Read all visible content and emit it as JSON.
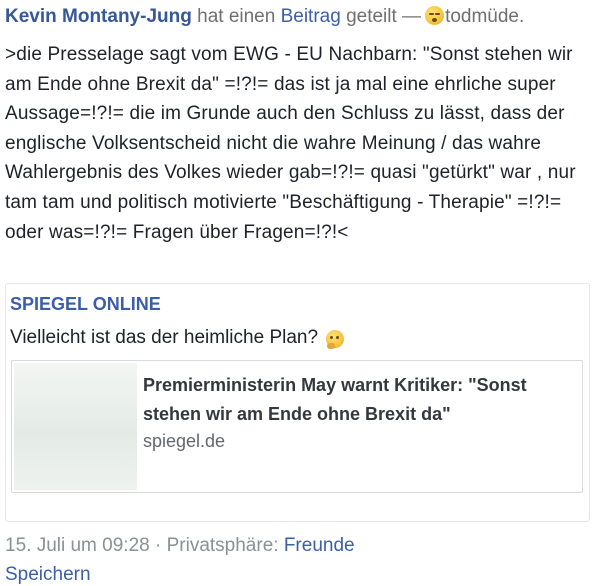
{
  "post": {
    "author": "Kevin Montany-Jung",
    "action_prefix": "hat einen",
    "action_link": "Beitrag",
    "action_suffix": "geteilt —",
    "feeling_icon": "sleepy-face-icon",
    "feeling": "todmüde.",
    "text": ">die Presselage sagt vom EWG - EU Nachbarn: \"Sonst stehen wir am Ende ohne Brexit da\" =!?!= das ist ja mal eine ehrliche super Aussage=!?!= die im Grunde auch den Schluss zu lässt, dass der englische Volksentscheid nicht die wahre Meinung / das wahre Wahlergebnis des Volkes wieder gab=!?!= quasi \"getürkt\" war , nur tam tam und politisch motivierte \"Beschäftigung - Therapie\" =!?!= oder was=!?!= Fragen über Fragen=!?!<"
  },
  "shared": {
    "source": "SPIEGEL ONLINE",
    "text": "Vielleicht ist das der heimliche Plan?",
    "emoji_icon": "thinking-face-icon",
    "link": {
      "title": "Premierministerin May warnt Kritiker: \"Sonst stehen wir am Ende ohne Brexit da\"",
      "domain": "spiegel.de"
    }
  },
  "meta": {
    "date": "15. Juli um 09:28",
    "separator": "·",
    "privacy_label": "Privatsphäre:",
    "privacy_value": "Freunde",
    "save": "Speichern"
  },
  "colors": {
    "link": "#3b5ea8",
    "author": "#365899",
    "muted": "#8b8f96"
  }
}
